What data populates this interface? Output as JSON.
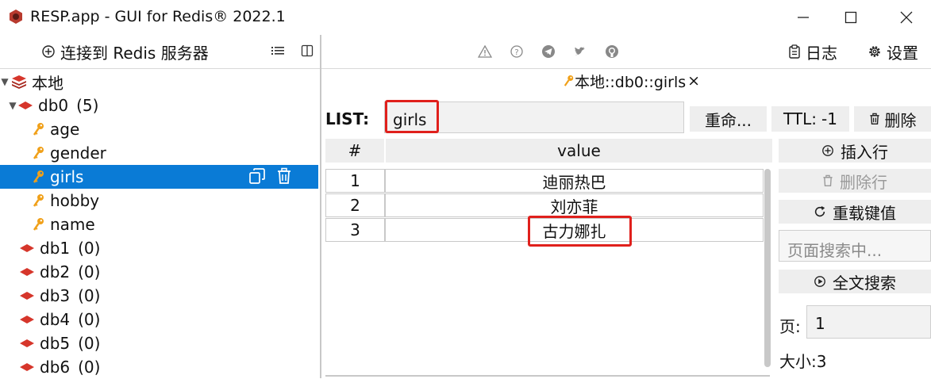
{
  "window": {
    "title": "RESP.app - GUI for Redis® 2022.1"
  },
  "left_toolbar": {
    "connect_label": "连接到 Redis 服务器"
  },
  "right_toolbar": {
    "icons": [
      "warning-icon",
      "help-icon",
      "telegram-icon",
      "twitter-icon",
      "github-icon"
    ],
    "log_label": "日志",
    "settings_label": "设置"
  },
  "tree": {
    "root_label": "本地",
    "db0_label": "db0",
    "db0_count": "(5)",
    "keys": [
      "age",
      "gender",
      "girls",
      "hobby",
      "name"
    ],
    "selected_key": "girls",
    "dbs": [
      {
        "name": "db1",
        "count": "(0)"
      },
      {
        "name": "db2",
        "count": "(0)"
      },
      {
        "name": "db3",
        "count": "(0)"
      },
      {
        "name": "db4",
        "count": "(0)"
      },
      {
        "name": "db5",
        "count": "(0)"
      },
      {
        "name": "db6",
        "count": "(0)"
      }
    ]
  },
  "tab": {
    "label": "本地::db0::girls",
    "close": "×"
  },
  "key_header": {
    "type_label": "LIST:",
    "key_name": "girls",
    "rename_label": "重命...",
    "ttl_label": "TTL:",
    "ttl_value": "-1",
    "delete_label": "删除"
  },
  "table": {
    "columns": [
      "#",
      "value"
    ],
    "rows": [
      {
        "index": "1",
        "value": "迪丽热巴"
      },
      {
        "index": "2",
        "value": "刘亦菲"
      },
      {
        "index": "3",
        "value": "古力娜扎"
      }
    ]
  },
  "side_panel": {
    "insert_label": "插入行",
    "delete_row_label": "删除行",
    "reload_label": "重载键值",
    "page_search_placeholder": "页面搜索中...",
    "fulltext_label": "全文搜索",
    "page_label": "页:",
    "page_value": "1",
    "size_label": "大小:",
    "size_value": "3"
  },
  "colors": {
    "selection": "#0a7bd6",
    "highlight_box": "#e0201c",
    "redis_red": "#d6362b",
    "key_orange": "#f0a019"
  }
}
